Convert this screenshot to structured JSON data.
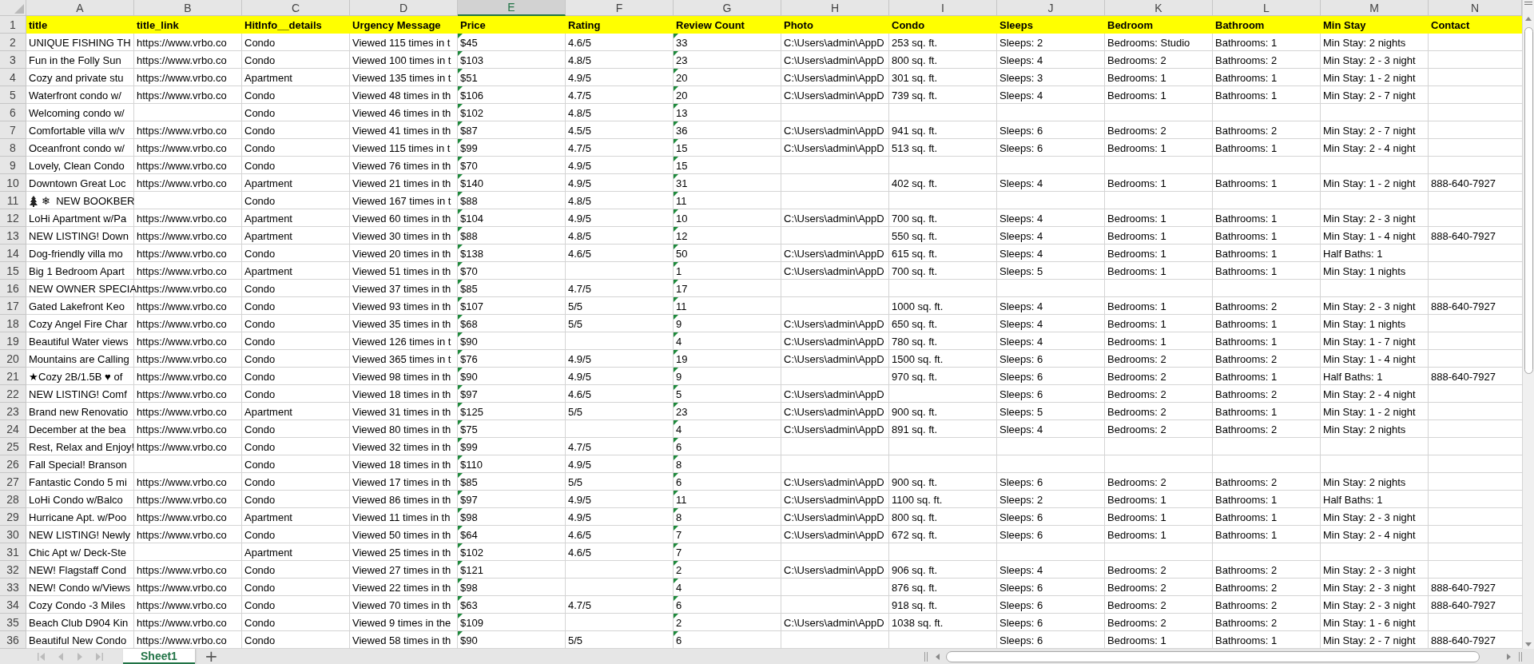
{
  "column_letters": [
    {
      "label": "A",
      "selected": false
    },
    {
      "label": "B",
      "selected": false
    },
    {
      "label": "C",
      "selected": false
    },
    {
      "label": "D",
      "selected": false
    },
    {
      "label": "E",
      "selected": true
    },
    {
      "label": "F",
      "selected": false
    },
    {
      "label": "G",
      "selected": false
    },
    {
      "label": "H",
      "selected": false
    },
    {
      "label": "I",
      "selected": false
    },
    {
      "label": "J",
      "selected": false
    },
    {
      "label": "K",
      "selected": false
    },
    {
      "label": "L",
      "selected": false
    },
    {
      "label": "M",
      "selected": false
    },
    {
      "label": "N",
      "selected": false
    }
  ],
  "table": {
    "header_row_number": "1",
    "columns": [
      {
        "title": "title",
        "number_as_text": false
      },
      {
        "title": "title_link",
        "number_as_text": false
      },
      {
        "title": "HitInfo__details",
        "number_as_text": false
      },
      {
        "title": "Urgency Message",
        "number_as_text": false
      },
      {
        "title": "Price",
        "number_as_text": true
      },
      {
        "title": "Rating",
        "number_as_text": false
      },
      {
        "title": "Review Count",
        "number_as_text": true
      },
      {
        "title": "Photo",
        "number_as_text": false
      },
      {
        "title": "Condo",
        "number_as_text": false
      },
      {
        "title": "Sleeps",
        "number_as_text": false
      },
      {
        "title": "Bedroom",
        "number_as_text": false
      },
      {
        "title": "Bathroom",
        "number_as_text": false
      },
      {
        "title": "Min Stay",
        "number_as_text": false
      },
      {
        "title": "Contact",
        "number_as_text": false
      }
    ],
    "rows": [
      {
        "number": "2",
        "cells": [
          "UNIQUE FISHING TH",
          "https://www.vrbo.co",
          "Condo",
          "Viewed 115 times in t",
          "$45",
          "4.6/5",
          "33",
          "C:\\Users\\admin\\AppD",
          "253 sq. ft.",
          "Sleeps: 2",
          "Bedrooms: Studio",
          "Bathrooms: 1",
          "Min Stay: 2 nights",
          null
        ]
      },
      {
        "number": "3",
        "cells": [
          "Fun in the Folly Sun",
          "https://www.vrbo.co",
          "Condo",
          "Viewed 100 times in t",
          "$103",
          "4.8/5",
          "23",
          "C:\\Users\\admin\\AppD",
          "800 sq. ft.",
          "Sleeps: 4",
          "Bedrooms: 2",
          "Bathrooms: 2",
          "Min Stay: 2 - 3 night",
          null
        ]
      },
      {
        "number": "4",
        "cells": [
          "Cozy and private stu",
          "https://www.vrbo.co",
          "Apartment",
          "Viewed 135 times in t",
          "$51",
          "4.9/5",
          "20",
          "C:\\Users\\admin\\AppD",
          "301 sq. ft.",
          "Sleeps: 3",
          "Bedrooms: 1",
          "Bathrooms: 1",
          "Min Stay: 1 - 2 night",
          null
        ]
      },
      {
        "number": "5",
        "cells": [
          "Waterfront condo w/",
          "https://www.vrbo.co",
          "Condo",
          "Viewed 48 times in th",
          "$106",
          "4.7/5",
          "20",
          "C:\\Users\\admin\\AppD",
          "739 sq. ft.",
          "Sleeps: 4",
          "Bedrooms: 1",
          "Bathrooms: 1",
          "Min Stay: 2 - 7 night",
          null
        ]
      },
      {
        "number": "6",
        "cells": [
          "Welcoming condo w/",
          null,
          "Condo",
          "Viewed 46 times in th",
          "$102",
          "4.8/5",
          "13",
          null,
          null,
          null,
          null,
          null,
          null,
          null
        ]
      },
      {
        "number": "7",
        "cells": [
          "Comfortable villa w/v",
          "https://www.vrbo.co",
          "Condo",
          "Viewed 41 times in th",
          "$87",
          "4.5/5",
          "36",
          "C:\\Users\\admin\\AppD",
          "941 sq. ft.",
          "Sleeps: 6",
          "Bedrooms: 2",
          "Bathrooms: 2",
          "Min Stay: 2 - 7 night",
          null
        ]
      },
      {
        "number": "8",
        "cells": [
          "Oceanfront condo w/",
          "https://www.vrbo.co",
          "Condo",
          "Viewed 115 times in t",
          "$99",
          "4.7/5",
          "15",
          "C:\\Users\\admin\\AppD",
          "513 sq. ft.",
          "Sleeps: 6",
          "Bedrooms: 1",
          "Bathrooms: 1",
          "Min Stay: 2 - 4 night",
          null
        ]
      },
      {
        "number": "9",
        "cells": [
          "Lovely, Clean Condo",
          "https://www.vrbo.co",
          "Condo",
          "Viewed 76 times in th",
          "$70",
          "4.9/5",
          "15",
          null,
          null,
          null,
          null,
          null,
          null,
          null
        ]
      },
      {
        "number": "10",
        "cells": [
          "Downtown Great Loc",
          "https://www.vrbo.co",
          "Apartment",
          "Viewed 21 times in th",
          "$140",
          "4.9/5",
          "31",
          null,
          "402 sq. ft.",
          "Sleeps: 4",
          "Bedrooms: 1",
          "Bathrooms: 1",
          "Min Stay: 1 - 2 night",
          "888-640-7927"
        ]
      },
      {
        "number": "11",
        "cells": [
          {
            "kind": "tree_icon_text",
            "text": "❄  NEW BOOKBER"
          },
          null,
          "Condo",
          "Viewed 167 times in t",
          "$88",
          "4.8/5",
          "11",
          null,
          null,
          null,
          null,
          null,
          null,
          null
        ]
      },
      {
        "number": "12",
        "cells": [
          "LoHi Apartment w/Pa",
          "https://www.vrbo.co",
          "Apartment",
          "Viewed 60 times in th",
          "$104",
          "4.9/5",
          "10",
          "C:\\Users\\admin\\AppD",
          "700 sq. ft.",
          "Sleeps: 4",
          "Bedrooms: 1",
          "Bathrooms: 1",
          "Min Stay: 2 - 3 night",
          null
        ]
      },
      {
        "number": "13",
        "cells": [
          "NEW LISTING! Down",
          "https://www.vrbo.co",
          "Apartment",
          "Viewed 30 times in th",
          "$88",
          "4.8/5",
          "12",
          null,
          "550 sq. ft.",
          "Sleeps: 4",
          "Bedrooms: 1",
          "Bathrooms: 1",
          "Min Stay: 1 - 4 night",
          "888-640-7927"
        ]
      },
      {
        "number": "14",
        "cells": [
          "Dog-friendly villa mo",
          "https://www.vrbo.co",
          "Condo",
          "Viewed 20 times in th",
          "$138",
          "4.6/5",
          "50",
          "C:\\Users\\admin\\AppD",
          "615 sq. ft.",
          "Sleeps: 4",
          "Bedrooms: 1",
          "Bathrooms: 1",
          "Half Baths: 1",
          null
        ]
      },
      {
        "number": "15",
        "cells": [
          "Big 1 Bedroom Apart",
          "https://www.vrbo.co",
          "Apartment",
          "Viewed 51 times in th",
          "$70",
          null,
          "1",
          "C:\\Users\\admin\\AppD",
          "700 sq. ft.",
          "Sleeps: 5",
          "Bedrooms: 1",
          "Bathrooms: 1",
          "Min Stay: 1 nights",
          null
        ]
      },
      {
        "number": "16",
        "cells": [
          "NEW OWNER SPECIA",
          "https://www.vrbo.co",
          "Condo",
          "Viewed 37 times in th",
          "$85",
          "4.7/5",
          "17",
          null,
          null,
          null,
          null,
          null,
          null,
          null
        ]
      },
      {
        "number": "17",
        "cells": [
          "Gated Lakefront Keo",
          "https://www.vrbo.co",
          "Condo",
          "Viewed 93 times in th",
          "$107",
          "5/5",
          "11",
          null,
          "1000 sq. ft.",
          "Sleeps: 4",
          "Bedrooms: 1",
          "Bathrooms: 2",
          "Min Stay: 2 - 3 night",
          "888-640-7927"
        ]
      },
      {
        "number": "18",
        "cells": [
          "Cozy Angel Fire Char",
          "https://www.vrbo.co",
          "Condo",
          "Viewed 35 times in th",
          "$68",
          "5/5",
          "9",
          "C:\\Users\\admin\\AppD",
          "650 sq. ft.",
          "Sleeps: 4",
          "Bedrooms: 1",
          "Bathrooms: 1",
          "Min Stay: 1 nights",
          null
        ]
      },
      {
        "number": "19",
        "cells": [
          "Beautiful Water views",
          "https://www.vrbo.co",
          "Condo",
          "Viewed 126 times in t",
          "$90",
          null,
          "4",
          "C:\\Users\\admin\\AppD",
          "780 sq. ft.",
          "Sleeps: 4",
          "Bedrooms: 1",
          "Bathrooms: 1",
          "Min Stay: 1 - 7 night",
          null
        ]
      },
      {
        "number": "20",
        "cells": [
          "Mountains are Calling",
          "https://www.vrbo.co",
          "Condo",
          "Viewed 365 times in t",
          "$76",
          "4.9/5",
          "19",
          "C:\\Users\\admin\\AppD",
          "1500 sq. ft.",
          "Sleeps: 6",
          "Bedrooms: 2",
          "Bathrooms: 2",
          "Min Stay: 1 - 4 night",
          null
        ]
      },
      {
        "number": "21",
        "cells": [
          "★Cozy 2B/1.5B ♥ of",
          "https://www.vrbo.co",
          "Condo",
          "Viewed 98 times in th",
          "$90",
          "4.9/5",
          "9",
          null,
          "970 sq. ft.",
          "Sleeps: 6",
          "Bedrooms: 2",
          "Bathrooms: 1",
          "Half Baths: 1",
          "888-640-7927"
        ]
      },
      {
        "number": "22",
        "cells": [
          "NEW LISTING! Comf",
          "https://www.vrbo.co",
          "Condo",
          "Viewed 18 times in th",
          "$97",
          "4.6/5",
          "5",
          "C:\\Users\\admin\\AppD",
          null,
          "Sleeps: 6",
          "Bedrooms: 2",
          "Bathrooms: 2",
          "Min Stay: 2 - 4 night",
          null
        ]
      },
      {
        "number": "23",
        "cells": [
          "Brand new Renovatio",
          "https://www.vrbo.co",
          "Apartment",
          "Viewed 31 times in th",
          "$125",
          "5/5",
          "23",
          "C:\\Users\\admin\\AppD",
          "900 sq. ft.",
          "Sleeps: 5",
          "Bedrooms: 2",
          "Bathrooms: 1",
          "Min Stay: 1 - 2 night",
          null
        ]
      },
      {
        "number": "24",
        "cells": [
          "December at the bea",
          "https://www.vrbo.co",
          "Condo",
          "Viewed 80 times in th",
          "$75",
          null,
          "4",
          "C:\\Users\\admin\\AppD",
          "891 sq. ft.",
          "Sleeps: 4",
          "Bedrooms: 2",
          "Bathrooms: 2",
          "Min Stay: 2 nights",
          null
        ]
      },
      {
        "number": "25",
        "cells": [
          "Rest, Relax and Enjoy!",
          "https://www.vrbo.co",
          "Condo",
          "Viewed 32 times in th",
          "$99",
          "4.7/5",
          "6",
          null,
          null,
          null,
          null,
          null,
          null,
          null
        ]
      },
      {
        "number": "26",
        "cells": [
          "Fall Special! Branson",
          null,
          "Condo",
          "Viewed 18 times in th",
          "$110",
          "4.9/5",
          "8",
          null,
          null,
          null,
          null,
          null,
          null,
          null
        ]
      },
      {
        "number": "27",
        "cells": [
          "Fantastic Condo 5 mi",
          "https://www.vrbo.co",
          "Condo",
          "Viewed 17 times in th",
          "$85",
          "5/5",
          "6",
          "C:\\Users\\admin\\AppD",
          "900 sq. ft.",
          "Sleeps: 6",
          "Bedrooms: 2",
          "Bathrooms: 2",
          "Min Stay: 2 nights",
          null
        ]
      },
      {
        "number": "28",
        "cells": [
          "LoHi Condo w/Balco",
          "https://www.vrbo.co",
          "Condo",
          "Viewed 86 times in th",
          "$97",
          "4.9/5",
          "11",
          "C:\\Users\\admin\\AppD",
          "1100 sq. ft.",
          "Sleeps: 2",
          "Bedrooms: 1",
          "Bathrooms: 1",
          "Half Baths: 1",
          null
        ]
      },
      {
        "number": "29",
        "cells": [
          "Hurricane Apt. w/Poo",
          "https://www.vrbo.co",
          "Apartment",
          "Viewed 11 times in th",
          "$98",
          "4.9/5",
          "8",
          "C:\\Users\\admin\\AppD",
          "800 sq. ft.",
          "Sleeps: 6",
          "Bedrooms: 1",
          "Bathrooms: 1",
          "Min Stay: 2 - 3 night",
          null
        ]
      },
      {
        "number": "30",
        "cells": [
          "NEW LISTING! Newly",
          "https://www.vrbo.co",
          "Condo",
          "Viewed 50 times in th",
          "$64",
          "4.6/5",
          "7",
          "C:\\Users\\admin\\AppD",
          "672 sq. ft.",
          "Sleeps: 6",
          "Bedrooms: 1",
          "Bathrooms: 1",
          "Min Stay: 2 - 4 night",
          null
        ]
      },
      {
        "number": "31",
        "cells": [
          "Chic Apt w/ Deck-Ste",
          null,
          "Apartment",
          "Viewed 25 times in th",
          "$102",
          "4.6/5",
          "7",
          null,
          null,
          null,
          null,
          null,
          null,
          null
        ]
      },
      {
        "number": "32",
        "cells": [
          "NEW! Flagstaff Cond",
          "https://www.vrbo.co",
          "Condo",
          "Viewed 27 times in th",
          "$121",
          null,
          "2",
          "C:\\Users\\admin\\AppD",
          "906 sq. ft.",
          "Sleeps: 4",
          "Bedrooms: 2",
          "Bathrooms: 2",
          "Min Stay: 2 - 3 night",
          null
        ]
      },
      {
        "number": "33",
        "cells": [
          "NEW! Condo w/Views",
          "https://www.vrbo.co",
          "Condo",
          "Viewed 22 times in th",
          "$98",
          null,
          "4",
          null,
          "876 sq. ft.",
          "Sleeps: 6",
          "Bedrooms: 2",
          "Bathrooms: 2",
          "Min Stay: 2 - 3 night",
          "888-640-7927"
        ]
      },
      {
        "number": "34",
        "cells": [
          "Cozy Condo -3 Miles",
          "https://www.vrbo.co",
          "Condo",
          "Viewed 70 times in th",
          "$63",
          "4.7/5",
          "6",
          null,
          "918 sq. ft.",
          "Sleeps: 6",
          "Bedrooms: 2",
          "Bathrooms: 2",
          "Min Stay: 2 - 3 night",
          "888-640-7927"
        ]
      },
      {
        "number": "35",
        "cells": [
          "Beach Club D904 Kin",
          "https://www.vrbo.co",
          "Condo",
          "Viewed 9 times in the",
          "$109",
          null,
          "2",
          "C:\\Users\\admin\\AppD",
          "1038 sq. ft.",
          "Sleeps: 6",
          "Bedrooms: 2",
          "Bathrooms: 2",
          "Min Stay: 1 - 6 night",
          null
        ]
      },
      {
        "number": "36",
        "cells": [
          "Beautiful New Condo",
          "https://www.vrbo.co",
          "Condo",
          "Viewed 58 times in th",
          "$90",
          "5/5",
          "6",
          null,
          null,
          "Sleeps: 6",
          "Bedrooms: 1",
          "Bathrooms: 1",
          "Min Stay: 2 - 7 night",
          "888-640-7927"
        ]
      }
    ]
  },
  "sheet_tabs": [
    {
      "label": "Sheet1",
      "selected": true
    }
  ],
  "add_sheet_button": "+"
}
